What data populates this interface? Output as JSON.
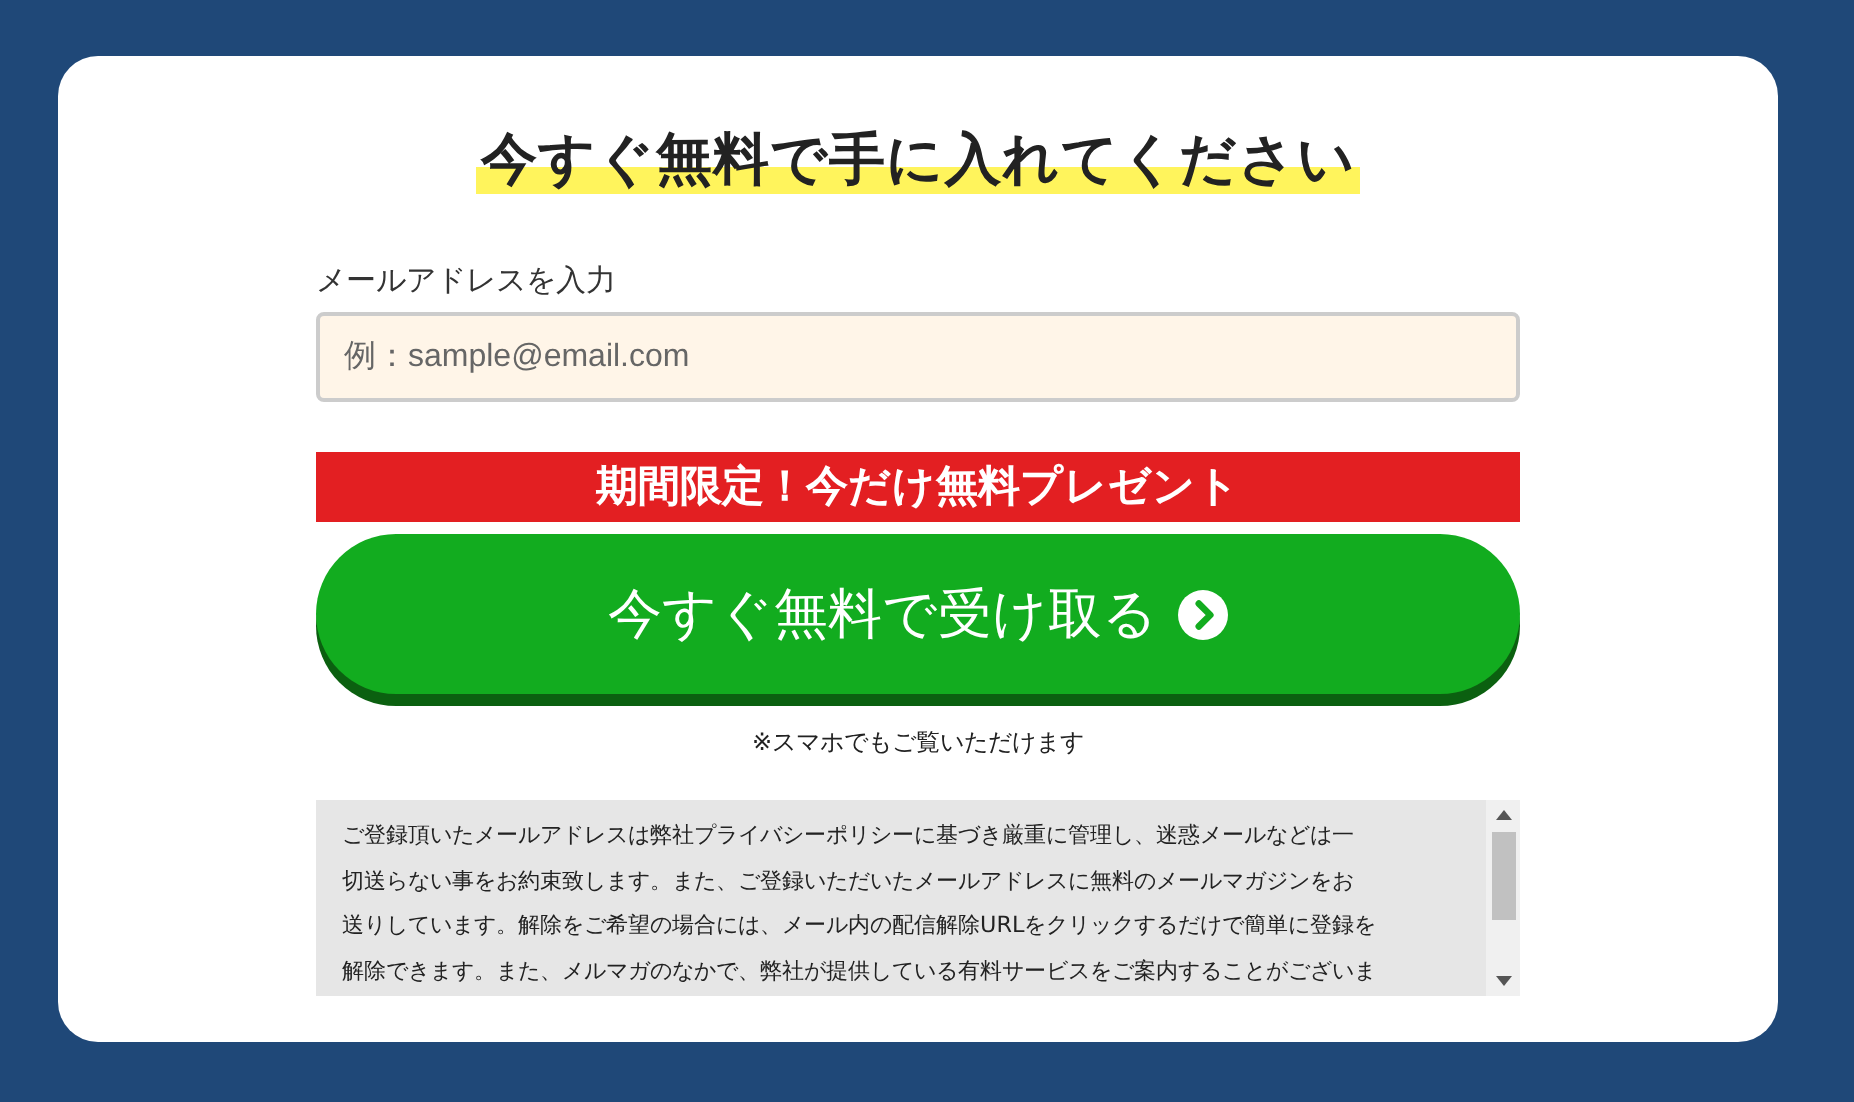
{
  "title": "今すぐ無料で手に入れてください",
  "email_field": {
    "label": "メールアドレスを入力",
    "placeholder": "例：sample@email.com"
  },
  "promo_banner": "期間限定！今だけ無料プレゼント",
  "submit_button": {
    "label": "今すぐ無料で受け取る"
  },
  "note": "※スマホでもご覧いただけます",
  "terms": {
    "lines": [
      "ご登録頂いたメールアドレスは弊社プライバシーポリシーに基づき厳重に管理し、迷惑メールなどは一",
      "切送らない事をお約束致します。また、ご登録いただいたメールアドレスに無料のメールマガジンをお",
      "送りしています。解除をご希望の場合には、メール内の配信解除URLをクリックするだけで簡単に登録を",
      "解除できます。また、メルマガのなかで、弊社が提供している有料サービスをご案内することがございま"
    ]
  }
}
